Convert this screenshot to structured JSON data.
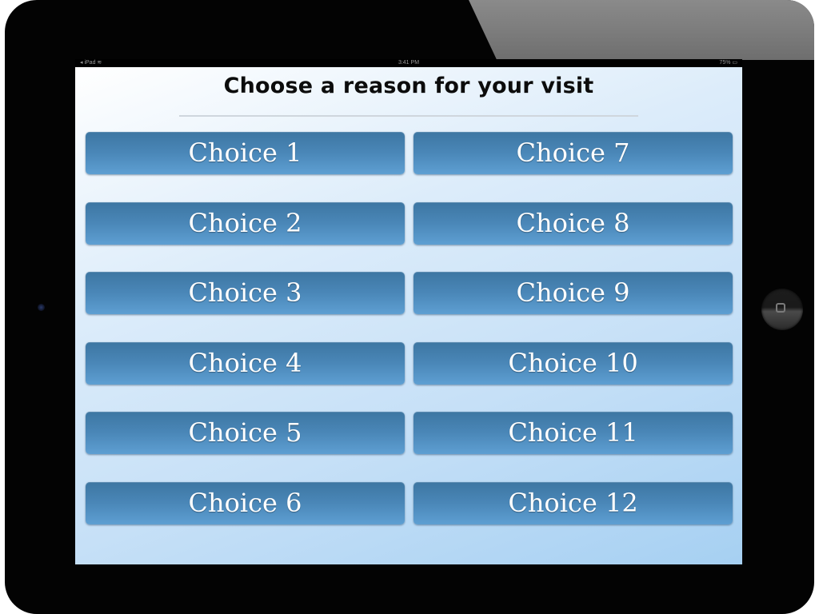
{
  "device": {
    "camera_icon": "front-camera-icon",
    "home_icon": "home-button-icon"
  },
  "statusbar": {
    "left": "◂ iPad ≋",
    "center": "3:41 PM",
    "right": "75% ▭"
  },
  "screen": {
    "title": "Choose a reason for your visit",
    "button_color": "#4a87b8",
    "choices": [
      {
        "label": "Choice 1"
      },
      {
        "label": "Choice 2"
      },
      {
        "label": "Choice 3"
      },
      {
        "label": "Choice 4"
      },
      {
        "label": "Choice 5"
      },
      {
        "label": "Choice 6"
      },
      {
        "label": "Choice 7"
      },
      {
        "label": "Choice 8"
      },
      {
        "label": "Choice 9"
      },
      {
        "label": "Choice 10"
      },
      {
        "label": "Choice 11"
      },
      {
        "label": "Choice 12"
      }
    ]
  }
}
